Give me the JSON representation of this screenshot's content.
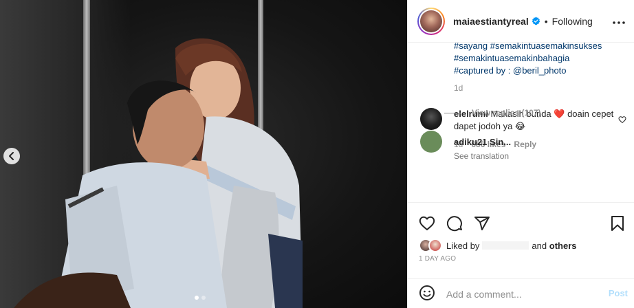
{
  "post": {
    "username": "maiaestiantyreal",
    "separator": "•",
    "follow_status": "Following",
    "caption_lines": [
      "#sayang #semakintuasemakinsukses",
      "#semakintuasemakinbahagia",
      "#captured by : @beril_photo"
    ],
    "caption_time": "1d"
  },
  "comment": {
    "username": "elelrumi",
    "text": "Makasih bunda ❤️ doain cepet dapet jodoh ya 😂",
    "time": "1d",
    "likes": "686 likes",
    "reply_label": "Reply",
    "see_translation": "See translation",
    "view_replies": "View replies (107)",
    "next_username_partial": "adiku21 Sin..."
  },
  "likes": {
    "prefix": "Liked by",
    "conjunction": "and",
    "others": "others"
  },
  "post_date": "1 DAY AGO",
  "composer": {
    "placeholder": "Add a comment...",
    "post_label": "Post"
  },
  "colors": {
    "link": "#00376b",
    "verified": "#0095f6",
    "post_disabled": "#b2dffc",
    "heart": "#ed4956"
  },
  "icons": [
    "verified-badge-icon",
    "more-options-icon",
    "heart-icon",
    "comment-icon",
    "share-icon",
    "bookmark-icon",
    "emoji-icon",
    "chevron-left-icon"
  ]
}
